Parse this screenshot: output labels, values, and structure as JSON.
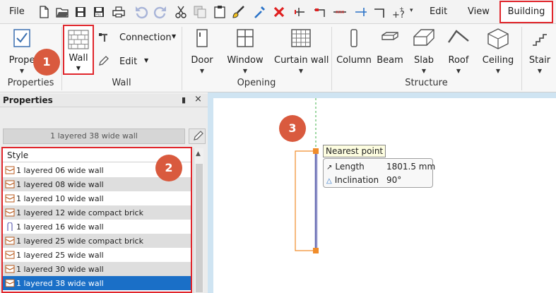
{
  "menu": {
    "file": "File",
    "edit": "Edit",
    "view": "View",
    "building": "Building"
  },
  "quick_toolbar": {
    "icons": [
      "new-file-icon",
      "open-folder-icon",
      "save-icon",
      "save-all-icon",
      "print-icon",
      "undo-icon",
      "redo-icon",
      "cut-icon",
      "copy-icon",
      "paste-icon",
      "brush-icon",
      "pipette-icon",
      "delete-icon",
      "snap-icon-1",
      "snap-icon-2",
      "snap-icon-3",
      "snap-icon-4",
      "snap-icon-5",
      "snap-help-icon"
    ]
  },
  "ribbon": {
    "properties_button": "Prope",
    "wall_button": "Wall",
    "connection_button": "Connection",
    "edit_button": "Edit",
    "door_button": "Door",
    "window_button": "Window",
    "curtain_wall_button": "Curtain wall",
    "column_button": "Column",
    "beam_button": "Beam",
    "slab_button": "Slab",
    "roof_button": "Roof",
    "ceiling_button": "Ceiling",
    "stair_button": "Stair",
    "groups": {
      "properties": "Properties",
      "wall": "Wall",
      "opening": "Opening",
      "structure": "Structure"
    }
  },
  "badges": {
    "one": "1",
    "two": "2",
    "three": "3"
  },
  "properties_panel": {
    "title": "Properties",
    "pin": "▮",
    "close": "×",
    "selected_wall": "1 layered 38 wide wall",
    "style_header": "Style",
    "styles": [
      {
        "label": "1 layered 06 wide wall",
        "icon": "wall-style-icon"
      },
      {
        "label": "1 layered 08 wide wall",
        "icon": "wall-style-icon"
      },
      {
        "label": "1 layered 10 wide wall",
        "icon": "wall-style-icon"
      },
      {
        "label": "1 layered 12 wide compact brick",
        "icon": "wall-style-icon"
      },
      {
        "label": "1 layered 16 wide wall",
        "icon": "wall-style-alt-icon"
      },
      {
        "label": "1 layered 25 wide compact brick",
        "icon": "wall-style-icon"
      },
      {
        "label": "1 layered 25 wide wall",
        "icon": "wall-style-icon"
      },
      {
        "label": "1 layered 30 wide wall",
        "icon": "wall-style-icon"
      },
      {
        "label": "1 layered 38 wide wall",
        "icon": "wall-style-icon"
      }
    ]
  },
  "canvas": {
    "nearest_point": "Nearest point",
    "length_label": "Length",
    "length_value": "1801.5 mm",
    "inclination_label": "Inclination",
    "inclination_value": "90°"
  },
  "colors": {
    "accent_red": "#e0262c",
    "badge": "#d95a3e",
    "selection_blue": "#1a6fc7",
    "wall_orange": "#f08c2a",
    "wall_line": "#6b6fb5"
  }
}
